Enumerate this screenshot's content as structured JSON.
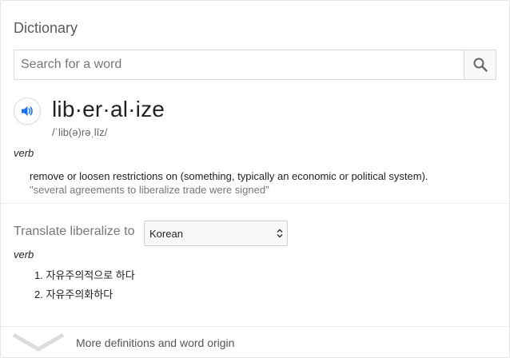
{
  "heading": "Dictionary",
  "search": {
    "placeholder": "Search for a word",
    "value": ""
  },
  "entry": {
    "word": "lib·er·al·ize",
    "phonetic": "/ˈlib(ə)rəˌlīz/",
    "part_of_speech": "verb",
    "definition": "remove or loosen restrictions on (something, typically an economic or political system).",
    "example": "\"several agreements to liberalize trade were signed\""
  },
  "translate": {
    "label": "Translate liberalize to",
    "selected_language": "Korean",
    "part_of_speech": "verb",
    "items": [
      {
        "num": "1.",
        "text": "자유주의적으로 하다"
      },
      {
        "num": "2.",
        "text": "자유주의화하다"
      }
    ]
  },
  "more_link": "More definitions and word origin",
  "colors": {
    "accent": "#1a73e8",
    "muted_text": "#777777",
    "divider": "#ececec"
  },
  "icons": {
    "search": "search-icon",
    "speaker": "speaker-icon",
    "expand": "chevron-down-icon",
    "select": "select-arrows-icon"
  }
}
